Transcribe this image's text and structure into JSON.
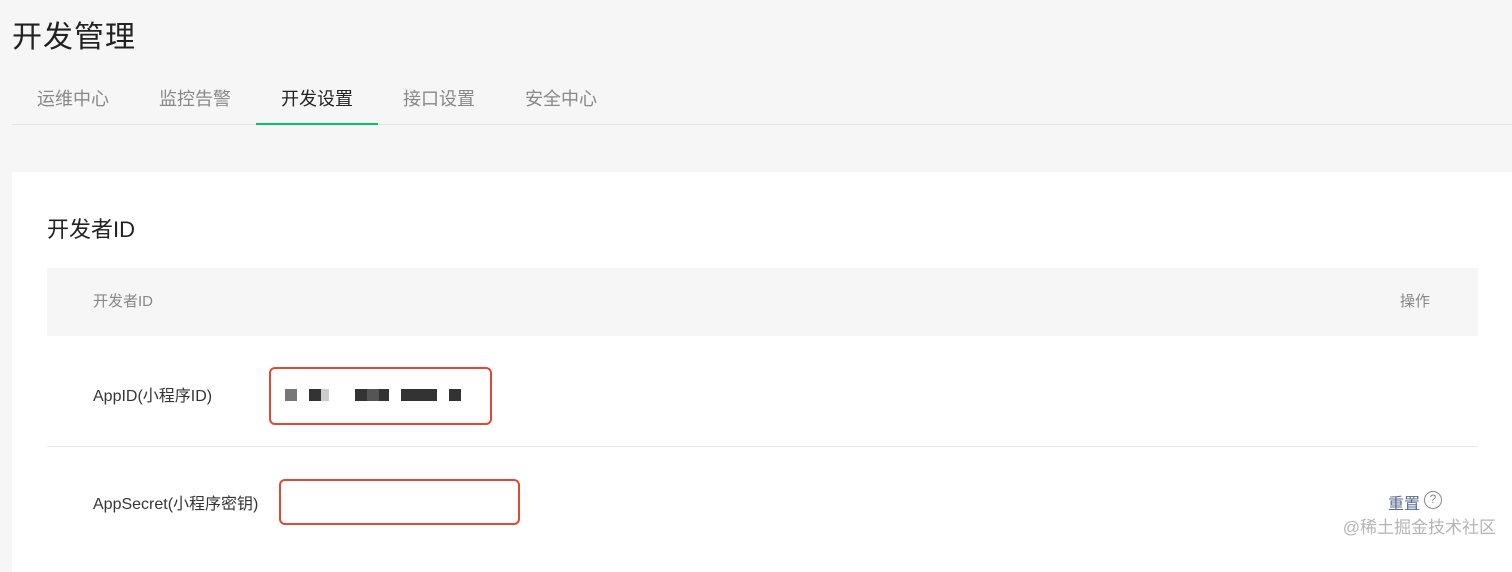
{
  "header": {
    "title": "开发管理"
  },
  "tabs": [
    {
      "label": "运维中心"
    },
    {
      "label": "监控告警"
    },
    {
      "label": "开发设置",
      "active": true
    },
    {
      "label": "接口设置"
    },
    {
      "label": "安全中心"
    }
  ],
  "section": {
    "title": "开发者ID",
    "table": {
      "headers": [
        "开发者ID",
        "操作"
      ],
      "rows": [
        {
          "label": "AppID(小程序ID)",
          "value": "",
          "value_note": "pixelated / redacted"
        },
        {
          "label": "AppSecret(小程序密钥)",
          "value": "",
          "action": "重置",
          "action_icon": "help-circle-icon"
        }
      ]
    }
  },
  "colors": {
    "accent": "#07c160",
    "link": "#576b95",
    "highlight": "#e04a34"
  },
  "watermark": "@稀土掘金技术社区"
}
